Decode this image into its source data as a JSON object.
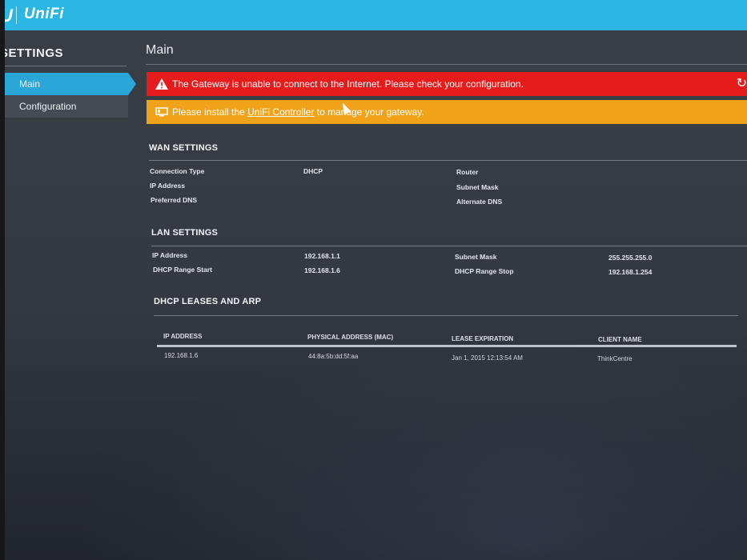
{
  "app": {
    "logo_mark": "U",
    "logo_text": "UniFi",
    "brand_color": "#2cb6e3"
  },
  "sidebar": {
    "title": "SETTINGS",
    "items": [
      {
        "label": "Main",
        "active": true
      },
      {
        "label": "Configuration",
        "active": false
      }
    ]
  },
  "main": {
    "title": "Main",
    "alerts": {
      "error": {
        "text": "The Gateway is unable to connect to the Internet. Please check your configuration.",
        "icon": "warning-triangle-icon",
        "action_icon": "refresh-icon",
        "color": "#e61c1c"
      },
      "info": {
        "text_before": "Please install the ",
        "link": "UniFi Controller",
        "text_after": " to manage your gateway.",
        "icon": "controller-icon",
        "color": "#f0a319"
      }
    },
    "wan": {
      "title": "WAN SETTINGS",
      "connection_type_label": "Connection Type",
      "connection_type_value": "DHCP",
      "ip_label": "IP Address",
      "ip_value": "",
      "dns_pref_label": "Preferred DNS",
      "dns_pref_value": "",
      "router_label": "Router",
      "router_value": "",
      "subnet_label": "Subnet Mask",
      "subnet_value": "",
      "dns_alt_label": "Alternate DNS",
      "dns_alt_value": ""
    },
    "lan": {
      "title": "LAN SETTINGS",
      "ip_label": "IP Address",
      "ip_value": "192.168.1.1",
      "range_start_label": "DHCP Range Start",
      "range_start_value": "192.168.1.6",
      "subnet_label": "Subnet Mask",
      "subnet_value": "255.255.255.0",
      "range_stop_label": "DHCP Range Stop",
      "range_stop_value": "192.168.1.254"
    },
    "leases": {
      "title": "DHCP LEASES AND ARP",
      "columns": [
        "IP ADDRESS",
        "PHYSICAL ADDRESS (MAC)",
        "LEASE EXPIRATION",
        "CLIENT NAME"
      ],
      "rows": [
        [
          "192.168.1.6",
          "44:8a:5b:dd:5f:aa",
          "Jan 1, 2015 12:13:54 AM",
          "ThinkCentre"
        ]
      ]
    }
  }
}
